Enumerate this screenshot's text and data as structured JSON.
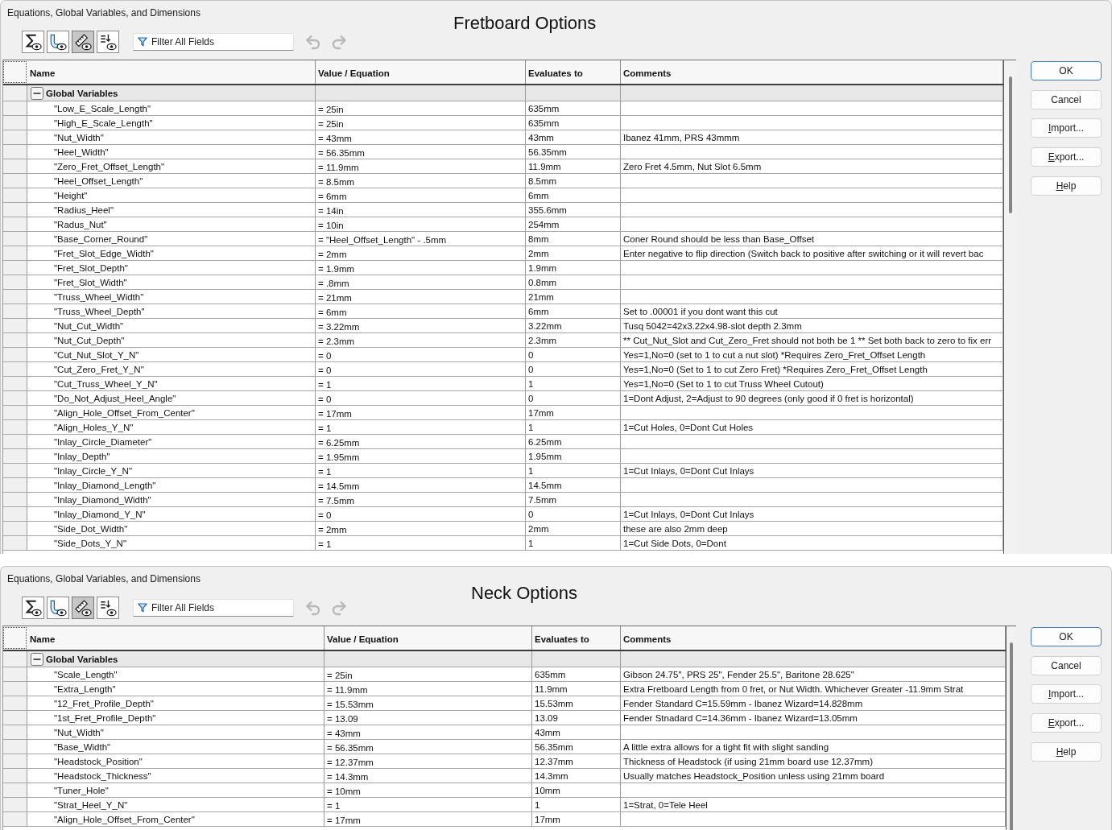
{
  "dialogs": [
    {
      "window": {
        "title": "Equations, Global Variables, and Dimensions"
      },
      "heading": "Fretboard Options",
      "toolbar": {
        "view_buttons": [
          {
            "kind": "sigma",
            "pressed": false
          },
          {
            "kind": "curve",
            "pressed": false
          },
          {
            "kind": "ruler",
            "pressed": true
          },
          {
            "kind": "order",
            "pressed": false
          }
        ],
        "filter": {
          "placeholder": "Filter All Fields"
        },
        "history_buttons": [
          {
            "kind": "undo",
            "disabled": true
          },
          {
            "kind": "redo",
            "disabled": true
          }
        ]
      },
      "table": {
        "columns": [
          "Name",
          "Value / Equation",
          "Evaluates to",
          "Comments"
        ],
        "groups": [
          {
            "label": "Global Variables",
            "expanded": true,
            "children": [
              {
                "name": "\"Low_E_Scale_Length\"",
                "value": "= 25in",
                "evaluates_to": "635mm"
              },
              {
                "name": "\"High_E_Scale_Length\"",
                "value": "= 25in",
                "evaluates_to": "635mm"
              },
              {
                "name": "\"Nut_Width\"",
                "value": "= 43mm",
                "evaluates_to": "43mm",
                "comments": "Ibanez 41mm, PRS 43mmm"
              },
              {
                "name": "\"Heel_Width\"",
                "value": "= 56.35mm",
                "evaluates_to": "56.35mm"
              },
              {
                "name": "\"Zero_Fret_Offset_Length\"",
                "value": "= 11.9mm",
                "evaluates_to": "11.9mm",
                "comments": "Zero Fret 4.5mm, Nut Slot 6.5mm"
              },
              {
                "name": "\"Heel_Offset_Length\"",
                "value": "= 8.5mm",
                "evaluates_to": "8.5mm"
              },
              {
                "name": "\"Height\"",
                "value": "= 6mm",
                "evaluates_to": "6mm"
              },
              {
                "name": "\"Radius_Heel\"",
                "value": "= 14in",
                "evaluates_to": "355.6mm"
              },
              {
                "name": "\"Radus_Nut\"",
                "value": "= 10in",
                "evaluates_to": "254mm"
              },
              {
                "name": "\"Base_Corner_Round\"",
                "value": "= \"Heel_Offset_Length\" - .5mm",
                "evaluates_to": "8mm",
                "comments": "Coner Round should be less than Base_Offset"
              },
              {
                "name": "\"Fret_Slot_Edge_Width\"",
                "value": "= 2mm",
                "evaluates_to": "2mm",
                "comments": "Enter negative to flip direction (Switch back to positive after switching or it will revert bac"
              },
              {
                "name": "\"Fret_Slot_Depth\"",
                "value": "= 1.9mm",
                "evaluates_to": "1.9mm"
              },
              {
                "name": "\"Fret_Slot_Width\"",
                "value": "= .8mm",
                "evaluates_to": "0.8mm"
              },
              {
                "name": "\"Truss_Wheel_Width\"",
                "value": "= 21mm",
                "evaluates_to": "21mm"
              },
              {
                "name": "\"Truss_Wheel_Depth\"",
                "value": "= 6mm",
                "evaluates_to": "6mm",
                "comments": "Set to .00001 if you dont want this cut"
              },
              {
                "name": "\"Nut_Cut_Width\"",
                "value": "= 3.22mm",
                "evaluates_to": "3.22mm",
                "comments": "Tusq 5042=42x3.22x4.98-slot depth 2.3mm"
              },
              {
                "name": "\"Nut_Cut_Depth\"",
                "value": "= 2.3mm",
                "evaluates_to": "2.3mm",
                "comments": "** Cut_Nut_Slot and Cut_Zero_Fret should not both be 1 ** Set both back to zero to fix err"
              },
              {
                "name": "\"Cut_Nut_Slot_Y_N\"",
                "value": "= 0",
                "evaluates_to": "0",
                "comments": "Yes=1,No=0 (set to 1 to cut a nut slot) *Requires Zero_Fret_Offset Length"
              },
              {
                "name": "\"Cut_Zero_Fret_Y_N\"",
                "value": "= 0",
                "evaluates_to": "0",
                "comments": "Yes=1,No=0 (Set to 1 to cut Zero Fret) *Requires Zero_Fret_Offset Length"
              },
              {
                "name": "\"Cut_Truss_Wheel_Y_N\"",
                "value": "= 1",
                "evaluates_to": "1",
                "comments": "Yes=1,No=0 (Set to 1 to cut Truss Wheel Cutout)"
              },
              {
                "name": "\"Do_Not_Adjust_Heel_Angle\"",
                "value": "= 0",
                "evaluates_to": "0",
                "comments": "1=Dont Adjust, 2=Adjust to 90 degrees (only good if 0 fret is horizontal)"
              },
              {
                "name": "\"Align_Hole_Offset_From_Center\"",
                "value": "= 17mm",
                "evaluates_to": "17mm"
              },
              {
                "name": "\"Align_Holes_Y_N\"",
                "value": "= 1",
                "evaluates_to": "1",
                "comments": "1=Cut Holes, 0=Dont Cut Holes"
              },
              {
                "name": "\"Inlay_Circle_Diameter\"",
                "value": "= 6.25mm",
                "evaluates_to": "6.25mm"
              },
              {
                "name": "\"Inlay_Depth\"",
                "value": "= 1.95mm",
                "evaluates_to": "1.95mm"
              },
              {
                "name": "\"Inlay_Circle_Y_N\"",
                "value": "= 1",
                "evaluates_to": "1",
                "comments": "1=Cut Inlays, 0=Dont Cut Inlays"
              },
              {
                "name": "\"Inlay_Diamond_Length\"",
                "value": "= 14.5mm",
                "evaluates_to": "14.5mm"
              },
              {
                "name": "\"Inlay_Diamond_Width\"",
                "value": "= 7.5mm",
                "evaluates_to": "7.5mm"
              },
              {
                "name": "\"Inlay_Diamond_Y_N\"",
                "value": "= 0",
                "evaluates_to": "0",
                "comments": "1=Cut Inlays, 0=Dont Cut Inlays"
              },
              {
                "name": "\"Side_Dot_Width\"",
                "value": "= 2mm",
                "evaluates_to": "2mm",
                "comments": "these are also 2mm deep"
              },
              {
                "name": "\"Side_Dots_Y_N\"",
                "value": "= 1",
                "evaluates_to": "1",
                "comments": "1=Cut Side Dots, 0=Dont"
              }
            ]
          }
        ]
      },
      "buttons": [
        {
          "label": "OK",
          "default": true,
          "mnemonic": false
        },
        {
          "label": "Cancel",
          "default": false,
          "mnemonic": false
        },
        {
          "label": "Import...",
          "default": false,
          "mnemonic": true
        },
        {
          "label": "Export...",
          "default": false,
          "mnemonic": true
        },
        {
          "label": "Help",
          "default": false,
          "mnemonic": true
        }
      ]
    },
    {
      "window": {
        "title": "Equations, Global Variables, and Dimensions"
      },
      "heading": "Neck Options",
      "toolbar": {
        "view_buttons": [
          {
            "kind": "sigma",
            "pressed": false
          },
          {
            "kind": "curve",
            "pressed": false
          },
          {
            "kind": "ruler",
            "pressed": true
          },
          {
            "kind": "order",
            "pressed": false
          }
        ],
        "filter": {
          "placeholder": "Filter All Fields"
        },
        "history_buttons": [
          {
            "kind": "undo",
            "disabled": true
          },
          {
            "kind": "redo",
            "disabled": true
          }
        ]
      },
      "table": {
        "columns": [
          "Name",
          "Value / Equation",
          "Evaluates to",
          "Comments"
        ],
        "groups": [
          {
            "label": "Global Variables",
            "expanded": true,
            "children": [
              {
                "name": "\"Scale_Length\"",
                "value": "= 25in",
                "evaluates_to": "635mm",
                "comments": "Gibson 24.75\", PRS 25\", Fender 25.5\", Baritone 28.625\""
              },
              {
                "name": "\"Extra_Length\"",
                "value": "= 11.9mm",
                "evaluates_to": "11.9mm",
                "comments": "Extra Fretboard Length from 0 fret, or Nut Width. Whichever Greater -11.9mm Strat"
              },
              {
                "name": "\"12_Fret_Profile_Depth\"",
                "value": "= 15.53mm",
                "evaluates_to": "15.53mm",
                "comments": "Fender Standard C=15.59mm - Ibanez Wizard=14.828mm"
              },
              {
                "name": "\"1st_Fret_Profile_Depth\"",
                "value": "= 13.09",
                "evaluates_to": "13.09",
                "comments": "Fender Stnadard C=14.36mm - Ibanez Wizard=13.05mm"
              },
              {
                "name": "\"Nut_Width\"",
                "value": "= 43mm",
                "evaluates_to": "43mm"
              },
              {
                "name": "\"Base_Width\"",
                "value": "= 56.35mm",
                "evaluates_to": "56.35mm",
                "comments": "A little extra allows for a tight fit with slight sanding"
              },
              {
                "name": "\"Headstock_Position\"",
                "value": "= 12.37mm",
                "evaluates_to": "12.37mm",
                "comments": "Thickness of Headstock (if using 21mm board use 12.37mm)"
              },
              {
                "name": "\"Headstock_Thickness\"",
                "value": "= 14.3mm",
                "evaluates_to": "14.3mm",
                "comments": "Usually matches Headstock_Position unless using 21mm board"
              },
              {
                "name": "\"Tuner_Hole\"",
                "value": "= 10mm",
                "evaluates_to": "10mm"
              },
              {
                "name": "\"Strat_Heel_Y_N\"",
                "value": "= 1",
                "evaluates_to": "1",
                "comments": "1=Strat, 0=Tele Heel"
              },
              {
                "name": "\"Align_Hole_Offset_From_Center\"",
                "value": "= 17mm",
                "evaluates_to": "17mm"
              }
            ]
          }
        ]
      },
      "buttons": [
        {
          "label": "OK",
          "default": true,
          "mnemonic": false
        },
        {
          "label": "Cancel",
          "default": false,
          "mnemonic": false
        },
        {
          "label": "Import...",
          "default": false,
          "mnemonic": true
        },
        {
          "label": "Export...",
          "default": false,
          "mnemonic": true
        },
        {
          "label": "Help",
          "default": false,
          "mnemonic": true
        }
      ]
    }
  ]
}
